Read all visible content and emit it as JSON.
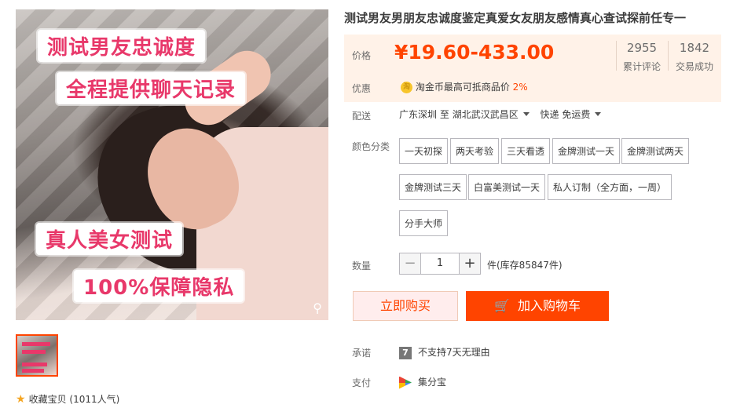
{
  "title": "测试男友男朋友忠诚度鉴定真爱女友朋友感情真心查试探前任专一",
  "image_tags": [
    "测试男友忠诚度",
    "全程提供聊天记录",
    "真人美女测试",
    "100%保障隐私"
  ],
  "thumb_texts": [
    "",
    "",
    "",
    ""
  ],
  "favorite": {
    "label": "收藏宝贝",
    "count": "(1011人气)"
  },
  "price": {
    "label": "价格",
    "value": "¥19.60-433.00",
    "reviews_num": "2955",
    "reviews_label": "累计评论",
    "deals_num": "1842",
    "deals_label": "交易成功"
  },
  "promo": {
    "label": "优惠",
    "coin": "淘",
    "text": "淘金币最高可抵商品价",
    "pct": "2%"
  },
  "shipping": {
    "label": "配送",
    "from": "广东深圳",
    "to_word": "至",
    "to": "湖北武汉武昌区",
    "method": "快递 免运费"
  },
  "color": {
    "label": "颜色分类",
    "options": [
      "一天初探",
      "两天考验",
      "三天看透",
      "金牌测试一天",
      "金牌测试两天",
      "金牌测试三天",
      "白富美测试一天",
      "私人订制（全方面，一周）",
      "分手大师"
    ]
  },
  "quantity": {
    "label": "数量",
    "minus": "−",
    "value": "1",
    "plus": "+",
    "stock": "件(库存85847件)"
  },
  "buttons": {
    "buy_now": "立即购买",
    "add_cart": "加入购物车"
  },
  "promise": {
    "label": "承诺",
    "icon": "7",
    "text": "不支持7天无理由"
  },
  "payment": {
    "label": "支付",
    "text": "集分宝"
  }
}
